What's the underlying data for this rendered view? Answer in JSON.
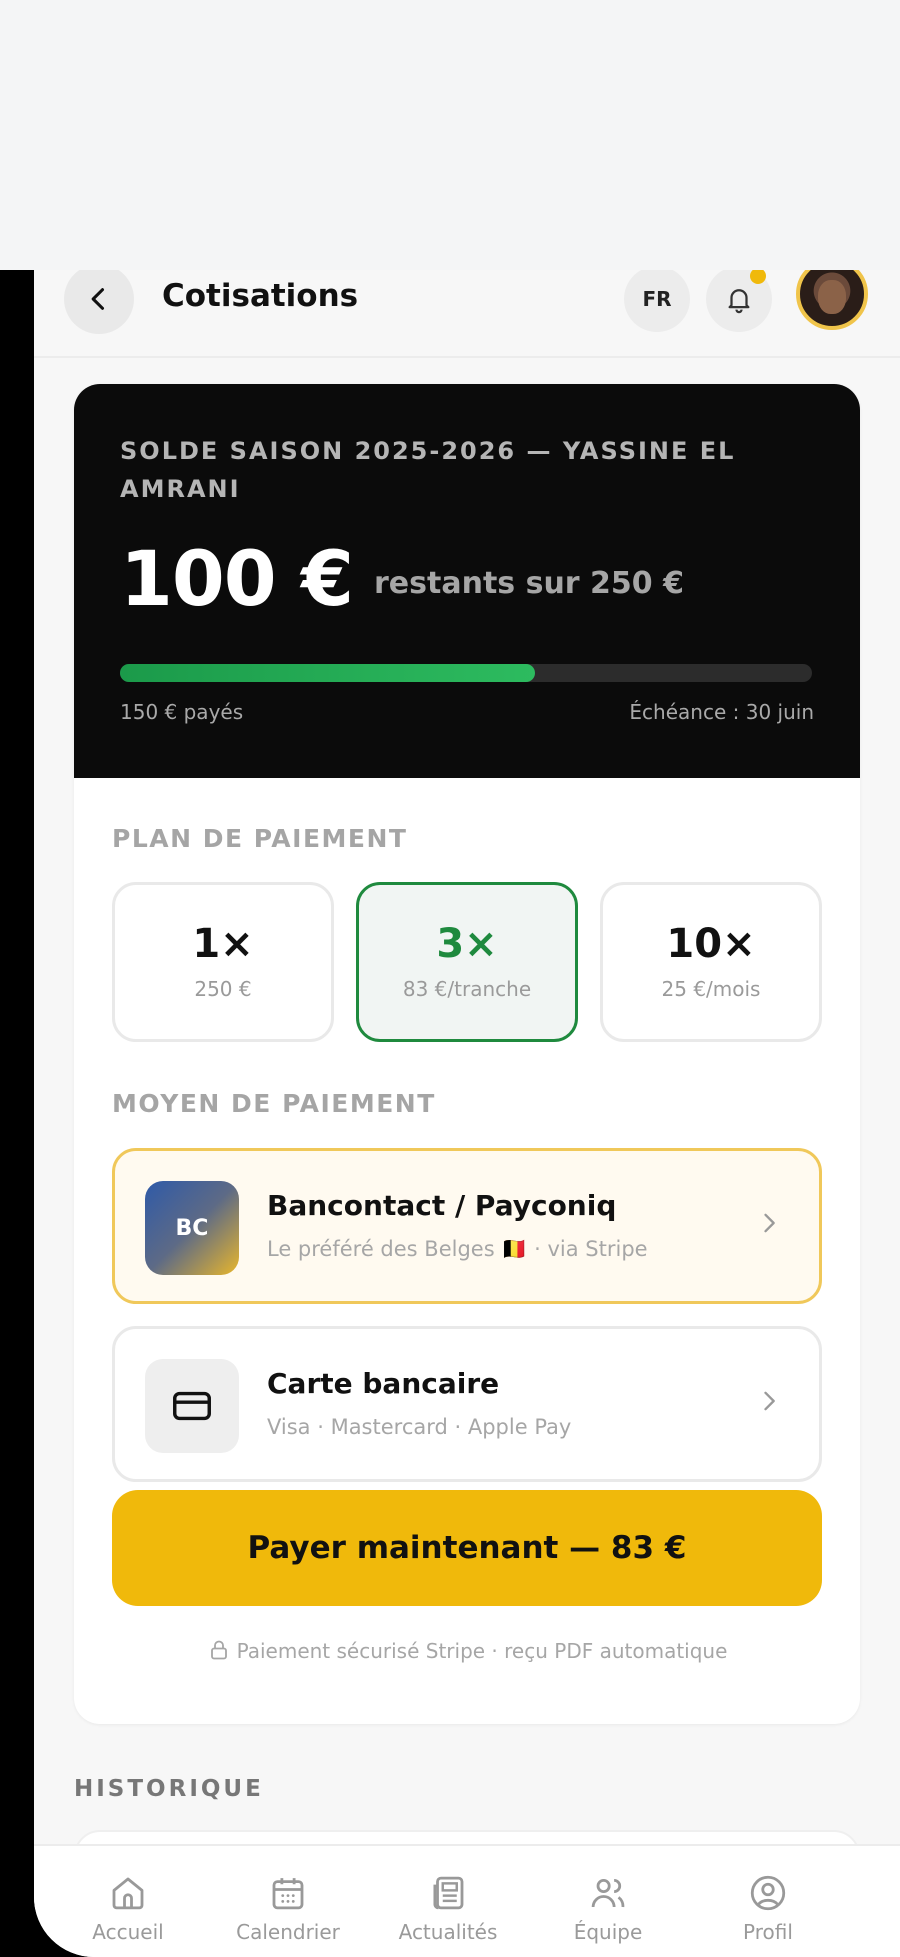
{
  "header": {
    "title": "Cotisations",
    "lang": "FR",
    "back_icon": "chevron-left-icon",
    "bell_icon": "bell-icon",
    "notification_dot_color": "#f0b90b"
  },
  "balance": {
    "heading": "SOLDE SAISON 2025-2026 — YASSINE EL AMRANI",
    "amount": "100 €",
    "remaining_text": "restants sur 250 €",
    "progress": 0.6,
    "paid_label": "150 € payés",
    "due_label": "Échéance : 30 juin",
    "progress_color": "#2dbb5f"
  },
  "plan": {
    "label": "PLAN DE PAIEMENT",
    "options": [
      {
        "count": "1×",
        "sub": "250 €",
        "selected": false
      },
      {
        "count": "3×",
        "sub": "83 €/tranche",
        "selected": true
      },
      {
        "count": "10×",
        "sub": "25 €/mois",
        "selected": false
      }
    ]
  },
  "method": {
    "label": "MOYEN DE PAIEMENT",
    "options": [
      {
        "icon_text": "BC",
        "title": "Bancontact / Payconiq",
        "sub": "Le préféré des Belges 🇧🇪 · via Stripe",
        "highlight": true
      },
      {
        "icon": "credit-card-icon",
        "title": "Carte bancaire",
        "sub": "Visa · Mastercard · Apple Pay",
        "highlight": false
      }
    ]
  },
  "pay_button": "Payer maintenant — 83 €",
  "secure_note": "Paiement sécurisé Stripe · reçu PDF automatique",
  "history_label": "HISTORIQUE",
  "nav": [
    {
      "label": "Accueil",
      "icon": "home-icon"
    },
    {
      "label": "Calendrier",
      "icon": "calendar-icon"
    },
    {
      "label": "Actualités",
      "icon": "newspaper-icon"
    },
    {
      "label": "Équipe",
      "icon": "team-icon"
    },
    {
      "label": "Profil",
      "icon": "profile-icon"
    }
  ],
  "colors": {
    "accent_yellow": "#f0b90b",
    "accent_green": "#1f8a3e",
    "dark": "#0b0b0b"
  }
}
